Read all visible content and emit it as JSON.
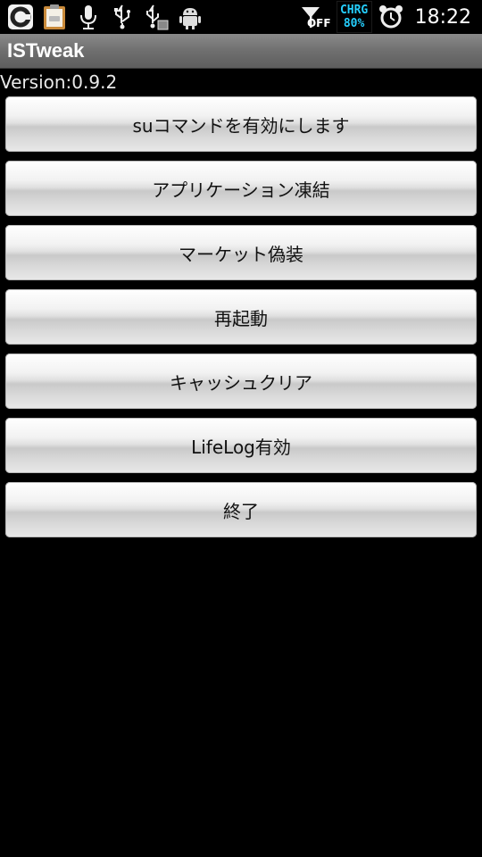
{
  "status_bar": {
    "left_icons": [
      "c-app-icon",
      "clipboard-icon",
      "microphone-icon",
      "usb-icon",
      "usb-debug-icon",
      "android-icon"
    ],
    "signal_off_label": "OFF",
    "battery": {
      "line1": "CHRG",
      "line2": "80%"
    },
    "alarm_icon": "alarm-clock-icon",
    "time": "18:22"
  },
  "app": {
    "title": "ISTweak",
    "version": "Version:0.9.2"
  },
  "buttons": [
    "suコマンドを有効にします",
    "アプリケーション凍結",
    "マーケット偽装",
    "再起動",
    "キャッシュクリア",
    "LifeLog有効",
    "終了"
  ]
}
